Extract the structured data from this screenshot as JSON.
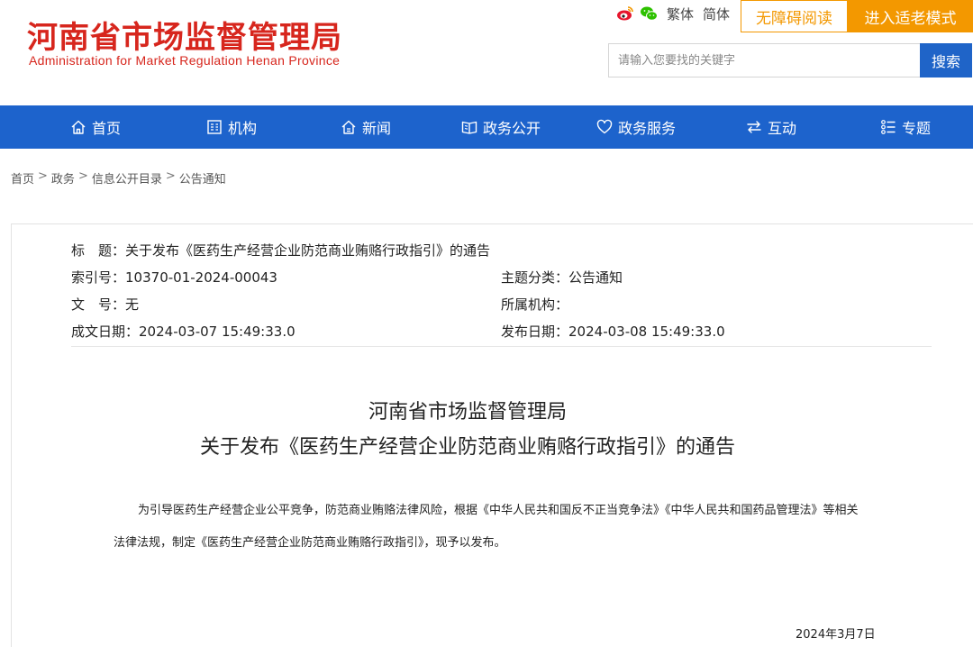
{
  "header": {
    "title_cn": "河南省市场监督管理局",
    "title_en": "Administration for Market Regulation Henan Province",
    "top_links": {
      "traditional": "繁体",
      "simplified": "简体"
    },
    "accessibility_label": "无障碍阅读",
    "elder_mode_label": "进入适老模式",
    "search": {
      "placeholder": "请输入您要找的关键字",
      "button_label": "搜索"
    },
    "icons": {
      "weibo": "weibo-icon",
      "wechat": "wechat-icon"
    }
  },
  "nav": {
    "items": [
      {
        "label": "首页",
        "icon": "home-icon"
      },
      {
        "label": "机构",
        "icon": "building-icon"
      },
      {
        "label": "新闻",
        "icon": "news-icon"
      },
      {
        "label": "政务公开",
        "icon": "open-book-icon"
      },
      {
        "label": "政务服务",
        "icon": "heart-icon"
      },
      {
        "label": "互动",
        "icon": "exchange-icon"
      },
      {
        "label": "专题",
        "icon": "list-icon"
      }
    ]
  },
  "breadcrumb": [
    "首页",
    "政务",
    "信息公开目录",
    "公告通知"
  ],
  "meta": {
    "title_label": "标　题：",
    "title_value": "关于发布《医药生产经营企业防范商业贿赂行政指引》的通告",
    "index_label": "索引号：",
    "index_value": "10370-01-2024-00043",
    "category_label": "主题分类：",
    "category_value": "公告通知",
    "docno_label": "文　号：",
    "docno_value": "无",
    "org_label": "所属机构：",
    "org_value": "",
    "created_label": "成文日期：",
    "created_value": "2024-03-07 15:49:33.0",
    "published_label": "发布日期：",
    "published_value": "2024-03-08 15:49:33.0"
  },
  "article": {
    "title_line1": "河南省市场监督管理局",
    "title_line2": "关于发布《医药生产经营企业防范商业贿赂行政指引》的通告",
    "para1": "为引导医药生产经营企业公平竞争，防范商业贿赂法律风险，根据《中华人民共和国反不正当竞争法》《中华人民共和国药品管理法》等相关",
    "para2": "法律法规，制定《医药生产经营企业防范商业贿赂行政指引》，现予以发布。",
    "date": "2024年3月7日"
  },
  "colors": {
    "brand_red": "#d7261d",
    "nav_blue": "#1d63cc",
    "accent_orange": "#f39800",
    "search_blue": "#1f64c8"
  }
}
